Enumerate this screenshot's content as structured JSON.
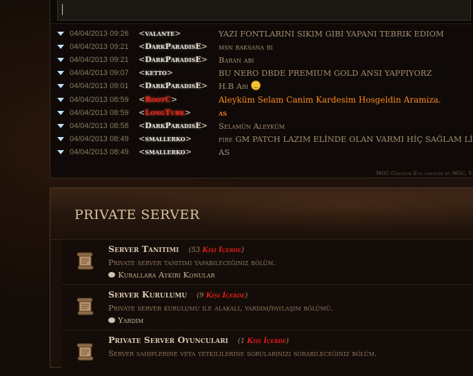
{
  "chat": {
    "input_value": "",
    "messages": [
      {
        "time": "04/04/2013 09:26",
        "user": "valante",
        "user_color": "white",
        "text": "YAZI FONTLARINI SIKIM GIBI YAPANI TEBRIK EDIOM",
        "text_style": "normal"
      },
      {
        "time": "04/04/2013 09:21",
        "user": "DarkParadisE",
        "user_color": "white",
        "text": "msn baksana bi",
        "text_style": "normal"
      },
      {
        "time": "04/04/2013 09:21",
        "user": "DarkParadisE",
        "user_color": "white",
        "text": "Baran abi",
        "text_style": "normal"
      },
      {
        "time": "04/04/2013 09:07",
        "user": "ketto",
        "user_color": "white",
        "text": "BU NERO DBDE PREMIUM GOLD ANSI YAPPIYORZ",
        "text_style": "normal"
      },
      {
        "time": "04/04/2013 09:01",
        "user": "DarkParadisE",
        "user_color": "white",
        "text": "H.B Abi",
        "text_style": "normal",
        "smiley": true
      },
      {
        "time": "04/04/2013 08:59",
        "user": "RootC",
        "user_color": "red",
        "text": "Aleyküm Selam Canim Kardesim Hosgeldin Aramiza.",
        "text_style": "orange"
      },
      {
        "time": "04/04/2013 08:59",
        "user": "LongTurk",
        "user_color": "red",
        "text": "as",
        "text_style": "orange-b"
      },
      {
        "time": "04/04/2013 08:58",
        "user": "DarkParadisE",
        "user_color": "white",
        "text": "Selamün Aleyküm",
        "text_style": "normal"
      },
      {
        "time": "04/04/2013 08:49",
        "user": "smallerko",
        "user_color": "white",
        "text": "fire GM PATCH LAZIM ELİNDE OLAN VARMI HİÇ SAĞLAM Lİ",
        "text_style": "normal"
      },
      {
        "time": "04/04/2013 08:49",
        "user": "smallerko",
        "user_color": "white",
        "text": "AS",
        "text_style": "normal"
      }
    ],
    "credit": "MGC Chatbox Evo created by MGC, Ve"
  },
  "forum": {
    "title": "PRIVATE SERVER",
    "rows": [
      {
        "title": "Server Tanıtımı",
        "count_prefix": "(53",
        "count_label": "Kişi İçerde",
        "count_suffix": ")",
        "desc": "Private server tanıtımı yapabileceğiniz bölüm.",
        "sub": "Kurallara Aykırı Konular"
      },
      {
        "title": "Server Kurulumu",
        "count_prefix": "(9",
        "count_label": "Kişi İçerde",
        "count_suffix": ")",
        "desc": "Private server kurulumu ile alakalı, yardım/paylaşım bölümü.",
        "sub": "Yardım"
      },
      {
        "title": "Private Server Oyuncuları",
        "count_prefix": "(1",
        "count_label": "Kişi İçerde",
        "count_suffix": ")",
        "desc": "Server sahiplerine veya yetkililerine sorularınızı sorabileceğiniz bölüm.",
        "sub": ""
      }
    ]
  },
  "colors": {
    "accent_red": "#e51d17",
    "accent_orange": "#ff8a1c",
    "arrow_blue": "#bfe3f7"
  },
  "icons": {
    "message_arrow": "down-triangle-icon",
    "forum_icon": "scroll-icon",
    "subforum_icon": "speech-bubble-icon"
  }
}
